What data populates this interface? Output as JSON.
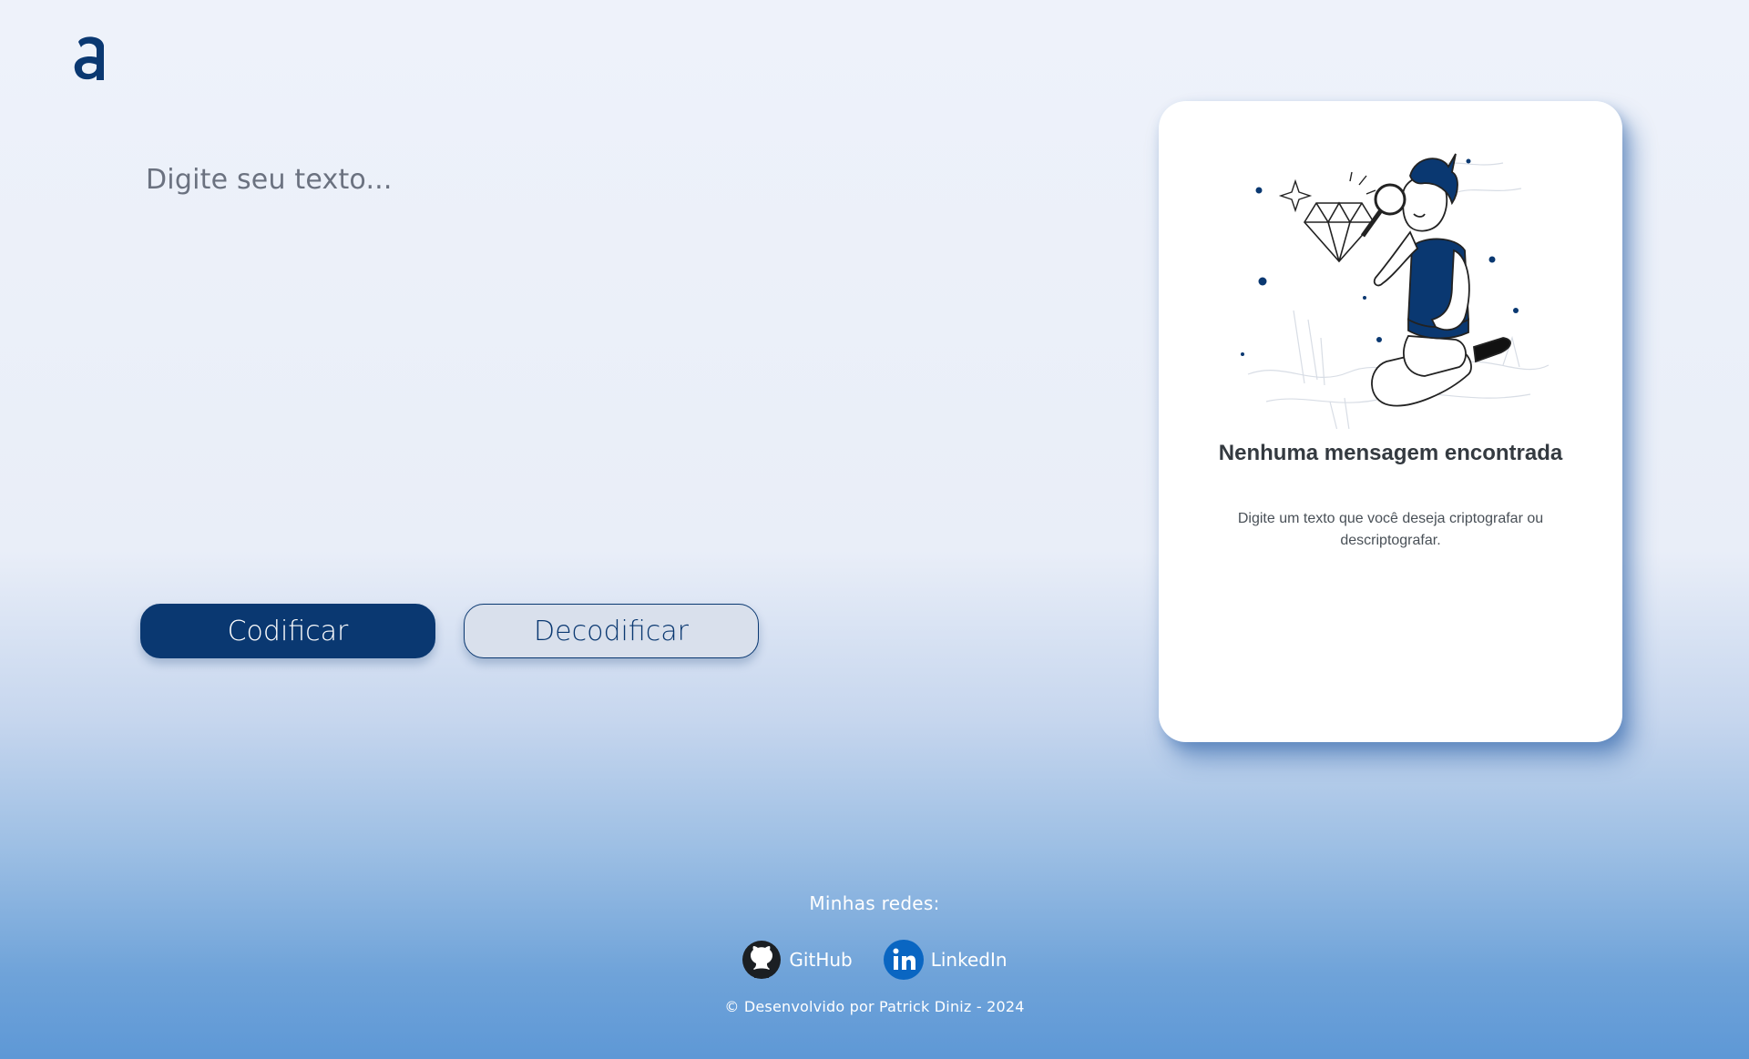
{
  "logo": {
    "icon": "a-logo-icon",
    "color": "#0a3871"
  },
  "input": {
    "placeholder": "Digite seu texto..."
  },
  "actions": {
    "encode_label": "Codificar",
    "decode_label": "Decodificar"
  },
  "output": {
    "title": "Nenhuma mensagem encontrada",
    "description": "Digite um texto que você deseja criptografar ou descriptografar."
  },
  "footer": {
    "label": "Minhas redes:",
    "links": [
      {
        "label": "GitHub",
        "icon": "github-icon"
      },
      {
        "label": "LinkedIn",
        "icon": "linkedin-icon"
      }
    ],
    "copyright": "© Desenvolvido por Patrick Diniz - 2024"
  },
  "colors": {
    "primary": "#0a3871",
    "secondary_button": "#d9e0ec",
    "card": "#ffffff",
    "linkedin": "#0a66c2"
  }
}
